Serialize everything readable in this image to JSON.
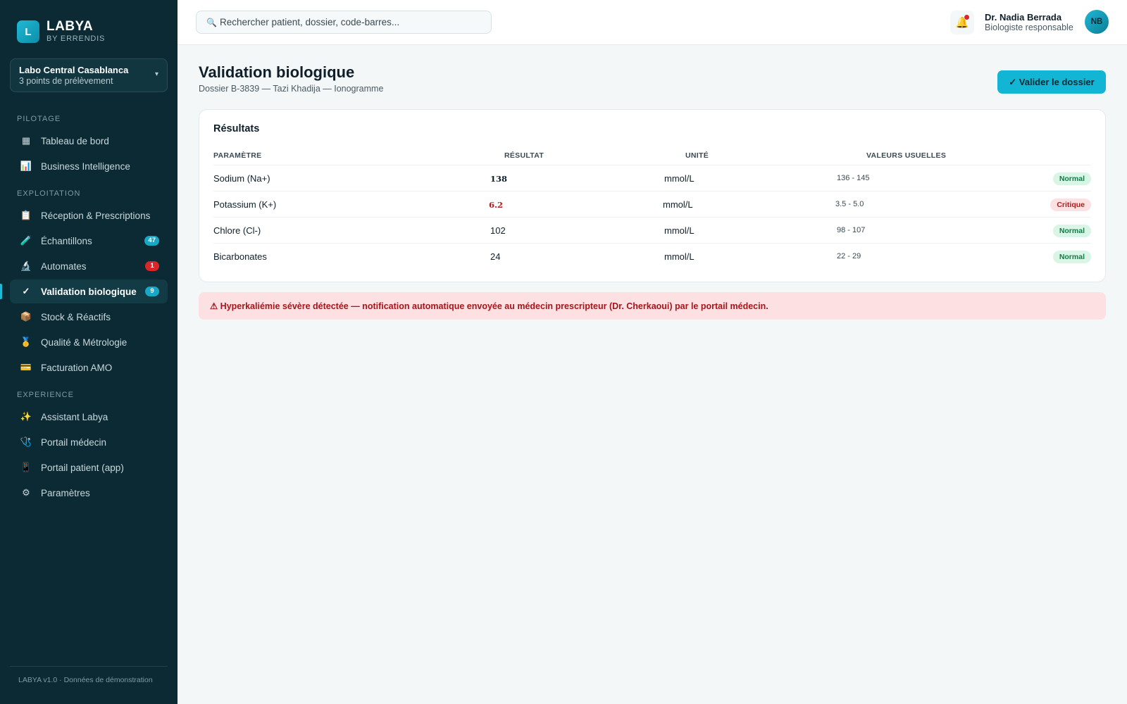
{
  "brand": {
    "logo": "L",
    "name": "LABYA",
    "subtitle": "BY ERRENDIS"
  },
  "lab": {
    "name": "Labo Central Casablanca",
    "sub": "3 points de prélèvement",
    "chevron": "▾"
  },
  "sidebar": {
    "sections": [
      "PILOTAGE",
      "EXPLOITATION",
      "EXPERIENCE"
    ],
    "items": [
      {
        "label": "Tableau de bord",
        "icon": "▦",
        "icon_name": "grid-icon"
      },
      {
        "label": "Business Intelligence",
        "icon": "📊",
        "icon_name": "chart-icon"
      },
      {
        "label": "Réception & Prescriptions",
        "icon": "📋",
        "icon_name": "clipboard-icon"
      },
      {
        "label": "Échantillons",
        "icon": "🧪",
        "icon_name": "test-tube-icon",
        "badge": "47"
      },
      {
        "label": "Automates",
        "icon": "🔬",
        "icon_name": "microscope-icon",
        "badge": "1"
      },
      {
        "label": "Validation biologique",
        "icon": "✓",
        "icon_name": "check-icon",
        "badge": "9",
        "active": true
      },
      {
        "label": "Stock & Réactifs",
        "icon": "📦",
        "icon_name": "box-icon"
      },
      {
        "label": "Qualité & Métrologie",
        "icon": "🥇",
        "icon_name": "medal-icon"
      },
      {
        "label": "Facturation AMO",
        "icon": "💳",
        "icon_name": "card-icon"
      },
      {
        "label": "Assistant Labya",
        "icon": "✨",
        "icon_name": "sparkles-icon"
      },
      {
        "label": "Portail médecin",
        "icon": "🩺",
        "icon_name": "stethoscope-icon"
      },
      {
        "label": "Portail patient (app)",
        "icon": "📱",
        "icon_name": "phone-icon"
      },
      {
        "label": "Paramètres",
        "icon": "⚙",
        "icon_name": "gear-icon"
      }
    ],
    "footer": "LABYA v1.0 · Données de démonstration"
  },
  "topbar": {
    "search_icon": "🔍",
    "search_placeholder": "Rechercher patient, dossier, code-barres...",
    "bell_icon": "🔔",
    "user_name": "Dr. Nadia Berrada",
    "user_role": "Biologiste responsable",
    "avatar": "NB"
  },
  "page": {
    "title": "Validation biologique",
    "subtitle": "Dossier B-3839 — Tazi Khadija — Ionogramme",
    "validate_button": "✓ Valider le dossier"
  },
  "results": {
    "title": "Résultats",
    "headers": [
      "PARAMÈTRE",
      "RÉSULTAT",
      "UNITÉ",
      "VALEURS USUELLES"
    ],
    "rows": [
      {
        "param": "Sodium (Na+)",
        "result": "138",
        "unit": "mmol/L",
        "ref": "136 - 145",
        "status": "Normal"
      },
      {
        "param": "Potassium (K+)",
        "result": "6.2",
        "unit": "mmol/L",
        "ref": "3.5 - 5.0",
        "status": "Critique"
      },
      {
        "param": "Chlore (Cl-)",
        "result": "102",
        "unit": "mmol/L",
        "ref": "98 - 107",
        "status": "Normal"
      },
      {
        "param": "Bicarbonates",
        "result": "24",
        "unit": "mmol/L",
        "ref": "22 - 29",
        "status": "Normal"
      }
    ]
  },
  "alert": "⚠ Hyperkaliémie sévère détectée — notification automatique envoyée au médecin prescripteur (Dr. Cherkaoui) par le portail médecin.",
  "colors": {
    "accent": "#12b5d3",
    "sidebar": "#0b2a33",
    "critical": "#d8262b",
    "normal": "#157a48"
  }
}
